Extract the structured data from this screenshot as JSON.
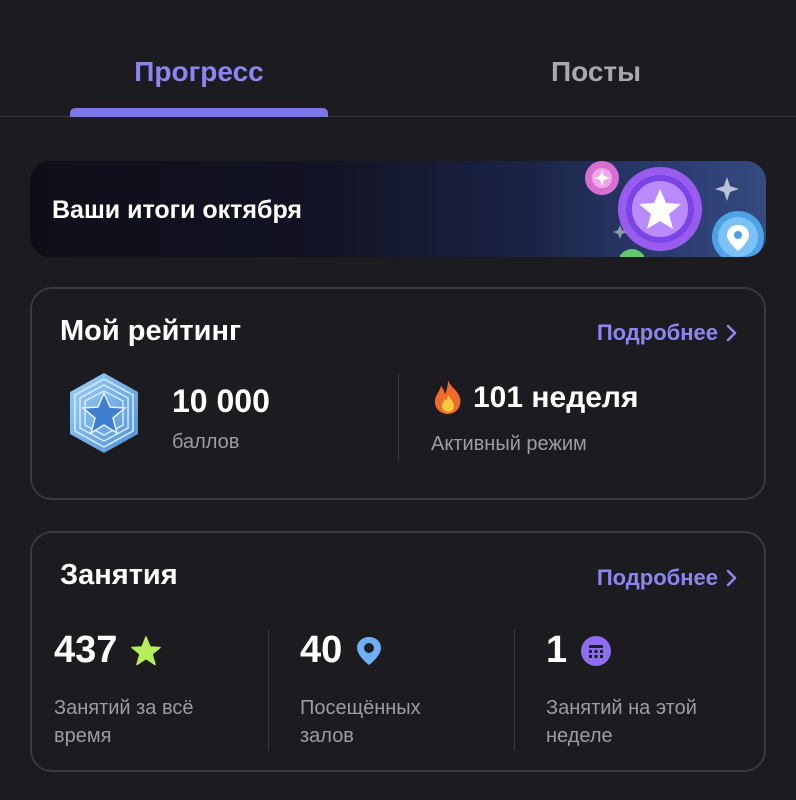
{
  "tabs": {
    "progress": "Прогресс",
    "posts": "Посты"
  },
  "banner": {
    "title": "Ваши итоги октября"
  },
  "rating": {
    "title": "Мой рейтинг",
    "more": "Подробнее",
    "points_value": "10 000",
    "points_label": "баллов",
    "streak_value": "101 неделя",
    "streak_label": "Активный режим"
  },
  "classes": {
    "title": "Занятия",
    "more": "Подробнее",
    "stats": [
      {
        "value": "437",
        "label": "Занятий за всё время",
        "icon": "star-icon"
      },
      {
        "value": "40",
        "label": "Посещённых залов",
        "icon": "location-pin-icon"
      },
      {
        "value": "1",
        "label": "Занятий на этой неделе",
        "icon": "calendar-icon"
      }
    ]
  },
  "colors": {
    "background": "#1c1b1f",
    "accent": "#8b86f0",
    "secondary_text": "#9d9ca2",
    "star": "#b6ee5a",
    "pin": "#6fb0f4",
    "calendar": "#8d6ef0"
  }
}
